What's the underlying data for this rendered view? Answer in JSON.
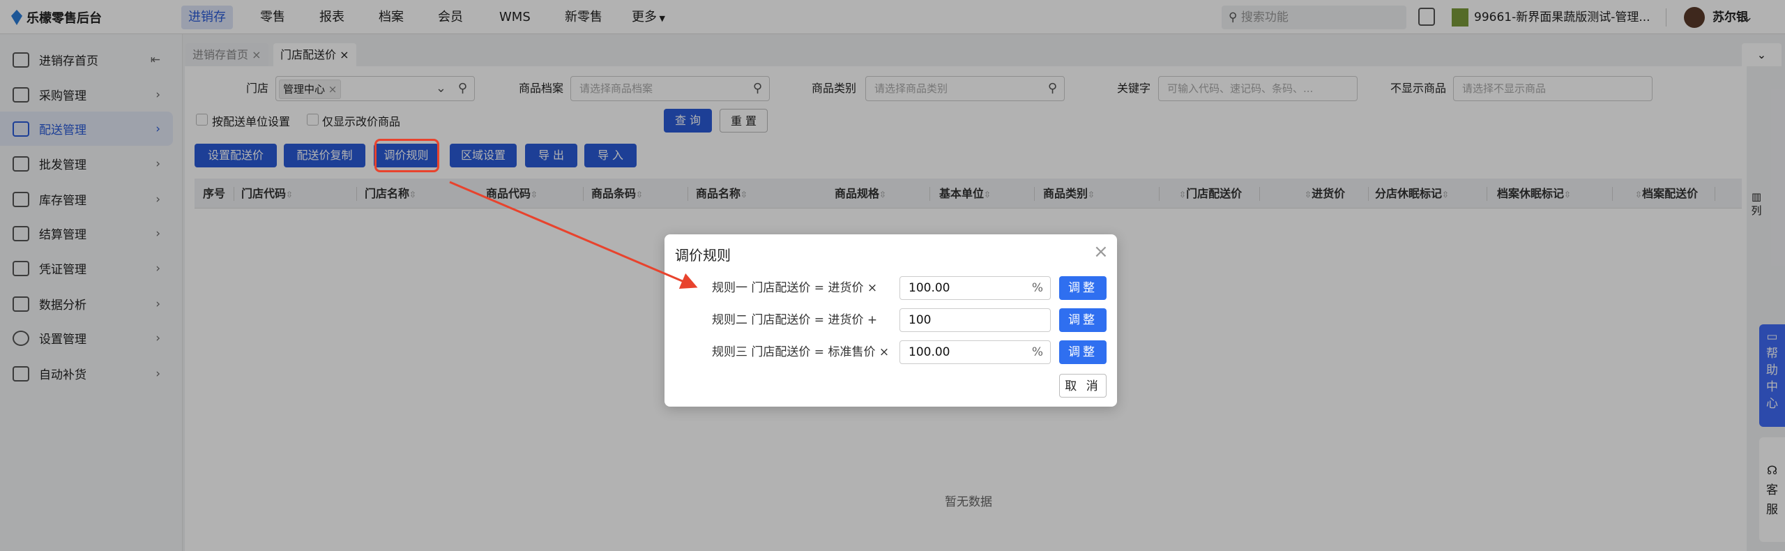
{
  "app": {
    "logo": "乐檬零售后台"
  },
  "topnav": [
    "进销存",
    "零售",
    "报表",
    "档案",
    "会员",
    "WMS",
    "新零售",
    "更多"
  ],
  "header": {
    "search_placeholder": "搜索功能",
    "store": "99661-新界面果蔬版测试-管理...",
    "user": "苏尔银"
  },
  "sidebar": {
    "items": [
      {
        "label": "进销存首页"
      },
      {
        "label": "采购管理"
      },
      {
        "label": "配送管理"
      },
      {
        "label": "批发管理"
      },
      {
        "label": "库存管理"
      },
      {
        "label": "结算管理"
      },
      {
        "label": "凭证管理"
      },
      {
        "label": "数据分析"
      },
      {
        "label": "设置管理"
      },
      {
        "label": "自动补货"
      }
    ]
  },
  "tabs": [
    {
      "label": "进销存首页"
    },
    {
      "label": "门店配送价"
    }
  ],
  "filters": {
    "store_label": "门店",
    "store_tag": "管理中心",
    "item_label": "商品档案",
    "item_ph": "请选择商品档案",
    "cat_label": "商品类别",
    "cat_ph": "请选择商品类别",
    "kw_label": "关键字",
    "kw_ph": "可输入代码、速记码、条码、...",
    "hide_label": "不显示商品",
    "hide_ph": "请选择不显示商品",
    "chk1": "按配送单位设置",
    "chk2": "仅显示改价商品",
    "query": "查 询",
    "reset": "重 置"
  },
  "toolbar": [
    "设置配送价",
    "配送价复制",
    "调价规则",
    "区域设置",
    "导 出",
    "导 入"
  ],
  "table": {
    "columns": [
      "序号",
      "门店代码",
      "门店名称",
      "商品代码",
      "商品条码",
      "商品名称",
      "商品规格",
      "基本单位",
      "商品类别",
      "门店配送价",
      "进货价",
      "分店休眠标记",
      "档案休眠标记",
      "档案配送价"
    ],
    "empty": "暂无数据",
    "col_setting": "列"
  },
  "side_widgets": {
    "help": "帮助中心",
    "service": "客服"
  },
  "modal": {
    "title": "调价规则",
    "rules": [
      {
        "label": "规则一  门店配送价 = 进货价 ×",
        "value": "100.00",
        "suffix": "%"
      },
      {
        "label": "规则二  门店配送价 = 进货价 +",
        "value": "100",
        "suffix": ""
      },
      {
        "label": "规则三  门店配送价 = 标准售价 ×",
        "value": "100.00",
        "suffix": "%"
      }
    ],
    "adjust": "调整",
    "cancel": "取 消"
  },
  "colors": {
    "accent": "#2a5bd7",
    "modal_btn": "#2f6ff0",
    "annotation": "#e8432d"
  }
}
